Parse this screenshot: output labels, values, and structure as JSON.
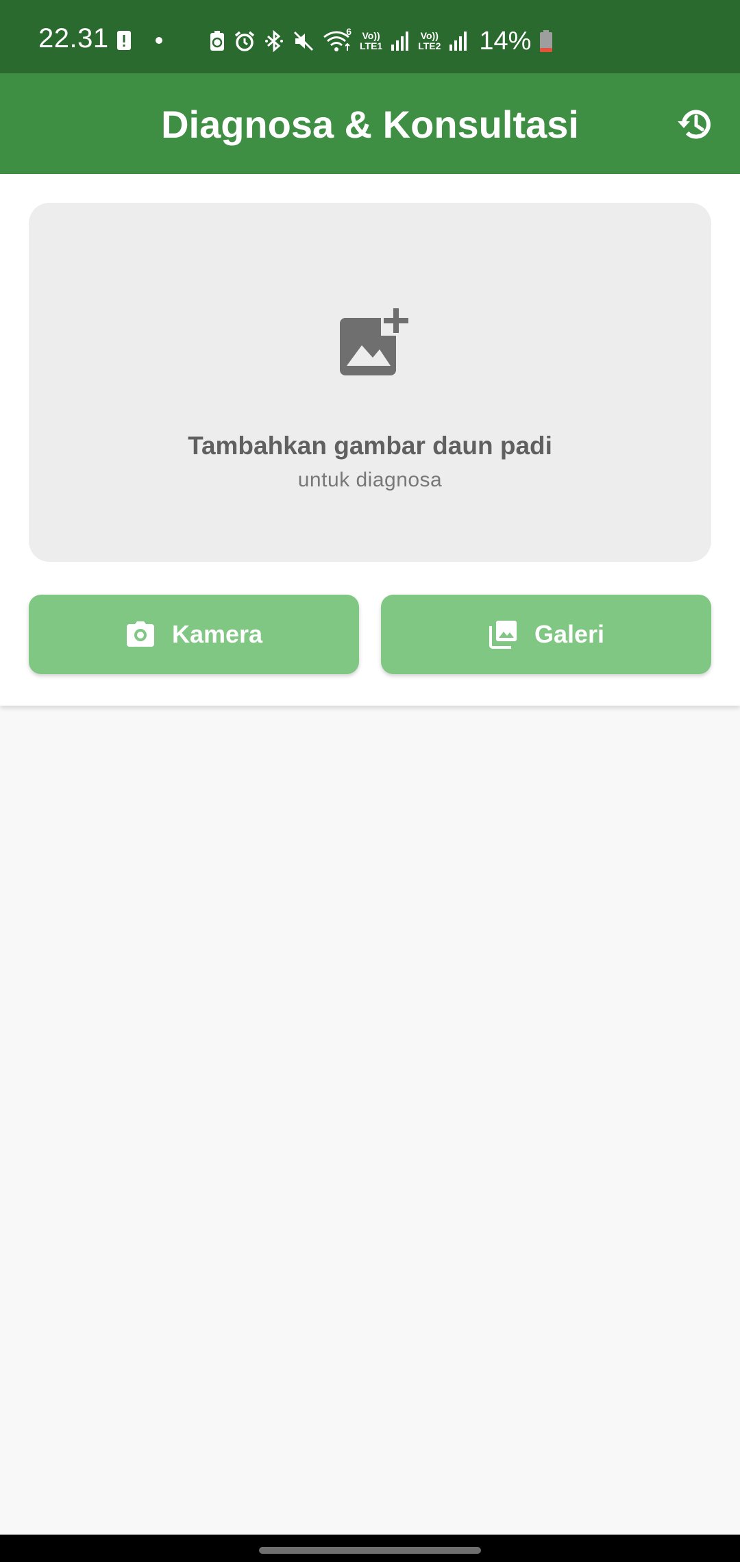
{
  "status_bar": {
    "time": "22.31",
    "lte1": {
      "top": "Vo))",
      "bottom": "LTE1"
    },
    "lte2": {
      "top": "Vo))",
      "bottom": "LTE2"
    },
    "wifi_badge": "6",
    "battery_percent": "14%",
    "icons": [
      "alert-icon",
      "dot-icon",
      "recycle-battery-icon",
      "alarm-icon",
      "bluetooth-icon",
      "mute-icon",
      "wifi-icon",
      "signal-icon",
      "signal-icon",
      "battery-icon"
    ]
  },
  "app_bar": {
    "title": "Diagnosa & Konsultasi",
    "history_icon": "history-icon"
  },
  "upload": {
    "icon": "add-photo-icon",
    "title": "Tambahkan gambar daun padi",
    "subtitle": "untuk diagnosa"
  },
  "buttons": {
    "camera": {
      "label": "Kamera",
      "icon": "camera-icon"
    },
    "gallery": {
      "label": "Galeri",
      "icon": "gallery-icon"
    }
  },
  "colors": {
    "status_bar": "#2b6a2f",
    "app_bar": "#3e8e43",
    "button": "#81c784",
    "drop_zone": "#ededed"
  }
}
